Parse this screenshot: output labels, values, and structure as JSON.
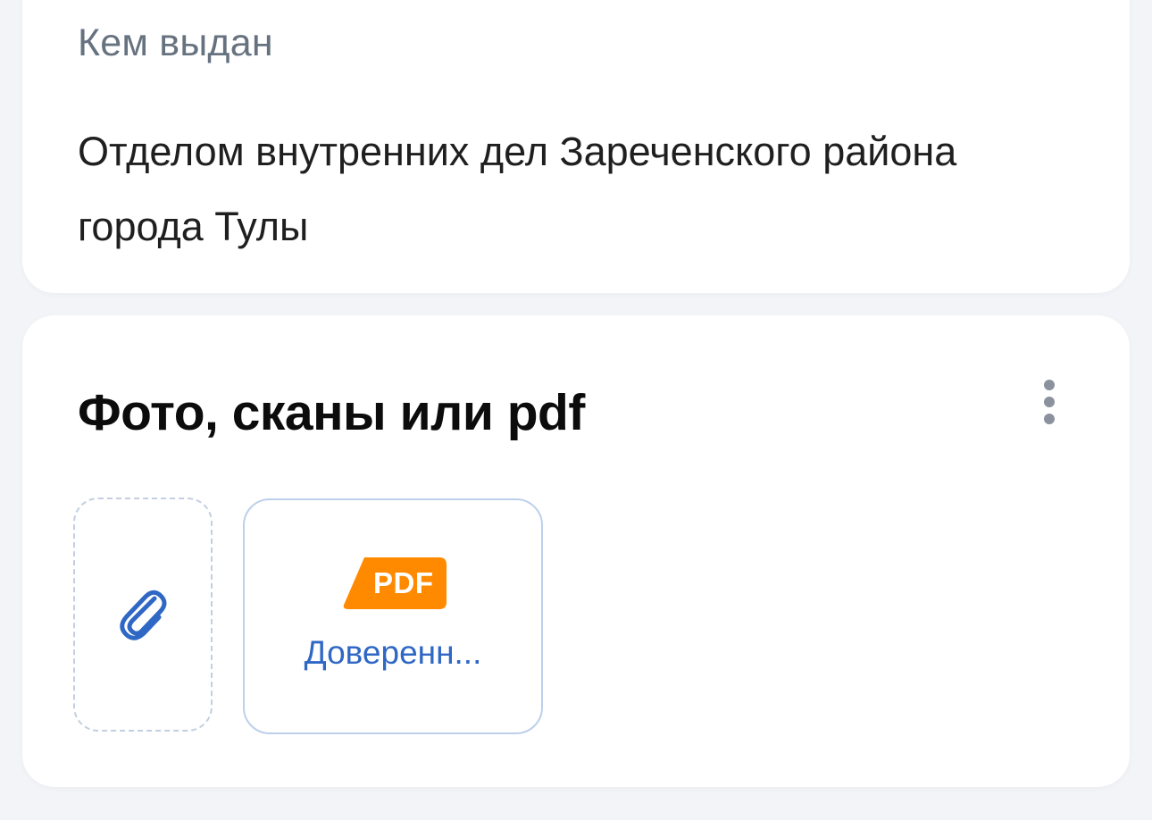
{
  "issued_by": {
    "label": "Кем выдан",
    "value": "Отделом внутренних дел Зареченского района города Тулы"
  },
  "attachments": {
    "title": "Фото, сканы или pdf",
    "more_icon": "more-vertical-icon",
    "attach_icon": "paperclip-icon",
    "files": [
      {
        "type_badge": "PDF",
        "name": "Доверенн..."
      }
    ]
  },
  "colors": {
    "background": "#f3f4f8",
    "card": "#ffffff",
    "label": "#66727f",
    "title": "#0c0c0d",
    "link_blue": "#2f67c4",
    "pdf_orange": "#ff8a00"
  }
}
